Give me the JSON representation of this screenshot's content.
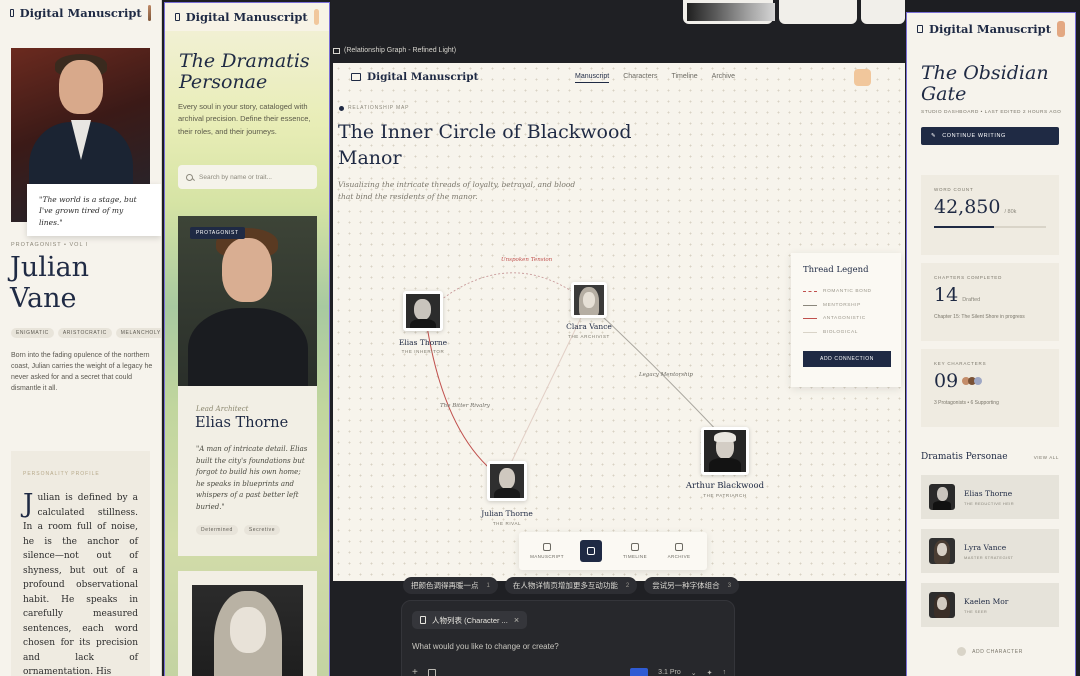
{
  "app": {
    "brand": "Digital Manuscript"
  },
  "panel1": {
    "quote": "\"The world is a stage, but I've grown tired of my lines.\"",
    "kicker": "PROTAGONIST • VOL I",
    "first_name": "Julian",
    "last_name": "Vane",
    "tags": [
      "ENIGMATIC",
      "ARISTOCRATIC",
      "MELANCHOLY"
    ],
    "bio": "Born into the fading opulence of the northern coast, Julian carries the weight of a legacy he never asked for and a secret that could dismantle it all.",
    "profile_heading": "PERSONALITY PROFILE",
    "profile_drop": "J",
    "profile_text": "ulian is defined by a calculated stillness. In a room full of noise, he is the anchor of silence—not out of shyness, but out of a profound observational habit. He speaks in carefully measured sentences, each word chosen for its precision and lack of ornamentation. His"
  },
  "panel2": {
    "title": "The Dramatis Personae",
    "description": "Every soul in your story, cataloged with archival precision. Define their essence, their roles, and their journeys.",
    "search_placeholder": "Search by name or trait...",
    "card": {
      "badge": "PROTAGONIST",
      "role": "Lead Architect",
      "name": "Elias Thorne",
      "quote": "\"A man of intricate detail. Elias built the city's foundations but forgot to build his own home; he speaks in blueprints and whispers of a past better left buried.\"",
      "tags": [
        "Determined",
        "Secretive"
      ]
    }
  },
  "panel3": {
    "window_title": "(Relationship Graph - Refined Light)",
    "nav": {
      "items": [
        "Manuscript",
        "Characters",
        "Timeline",
        "Archive"
      ],
      "active": "Manuscript"
    },
    "kicker": "RELATIONSHIP MAP",
    "title": "The Inner Circle of Blackwood Manor",
    "subtitle": "Visualizing the intricate threads of loyalty, betrayal, and blood that bind the residents of the manor.",
    "nodes": [
      {
        "name": "Elias Thorne",
        "role": "THE INHERITOR"
      },
      {
        "name": "Clara Vance",
        "role": "THE ARCHIVIST"
      },
      {
        "name": "Julian Thorne",
        "role": "THE RIVAL"
      },
      {
        "name": "Arthur Blackwood",
        "role": "THE PATRIARCH"
      }
    ],
    "edge_labels": {
      "unspoken": "Unspoken Tension",
      "mentorship": "Legacy Mentorship",
      "rivalry": "The Bitter Rivalry"
    },
    "legend": {
      "title": "Thread Legend",
      "items": [
        "ROMANTIC BOND",
        "MENTORSHIP",
        "ANTAGONISTIC",
        "BIOLOGICAL"
      ],
      "colors": [
        "#c0504d",
        "#8a877c",
        "#c0504d",
        "#d9d4c8"
      ],
      "button": "ADD CONNECTION"
    },
    "dock": [
      "MANUSCRIPT",
      "",
      "TIMELINE",
      "ARCHIVE"
    ],
    "suggestions": [
      {
        "text": "把颜色调得再暖一点",
        "num": "1"
      },
      {
        "text": "在人物详情页增加更多互动功能",
        "num": "2"
      },
      {
        "text": "尝试另一种字体组合",
        "num": "3"
      }
    ],
    "composer": {
      "tab": "人物列表 (Character ...",
      "placeholder": "What would you like to change or create?",
      "model": "3.1 Pro"
    }
  },
  "panel4": {
    "title": "The Obsidian Gate",
    "meta": "STUDIO DASHBOARD • LAST EDITED 2 HOURS AGO",
    "continue": "CONTINUE WRITING",
    "word_count": {
      "label": "WORD COUNT",
      "value": "42,850",
      "unit": "/ 80k",
      "progress": 0.5356
    },
    "chapters": {
      "label": "CHAPTERS COMPLETED",
      "value": "14",
      "unit": "Drafted",
      "note": "Chapter 15: The Silent Shore in progress"
    },
    "characters": {
      "label": "KEY CHARACTERS",
      "value": "09",
      "note": "3 Protagonists • 6 Supporting"
    },
    "dp_title": "Dramatis Personae",
    "view_all": "VIEW ALL",
    "people": [
      {
        "name": "Elias Thorne",
        "role": "THE REDUCTIVE HEIR"
      },
      {
        "name": "Lyra Vance",
        "role": "MASTER STRATEGIST"
      },
      {
        "name": "Kaelen Mor",
        "role": "THE SEER"
      }
    ],
    "add": "ADD CHARACTER"
  }
}
